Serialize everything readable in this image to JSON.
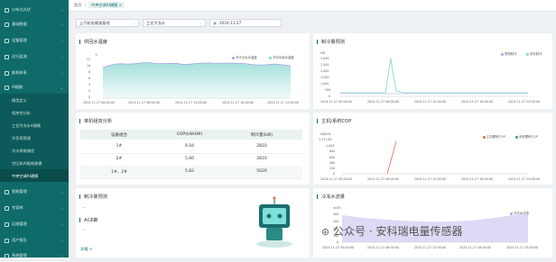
{
  "sidebar": {
    "items": [
      {
        "label": "分布式光伏"
      },
      {
        "label": "基础数据"
      },
      {
        "label": "设备管理"
      },
      {
        "label": "运行监测"
      },
      {
        "label": "能耗体系"
      },
      {
        "label": "AI赋能"
      }
    ],
    "subitems": [
      {
        "label": "模型定义"
      },
      {
        "label": "相关性分析"
      },
      {
        "label": "工艺冷冻水4建模"
      },
      {
        "label": "冷负荷预测"
      },
      {
        "label": "冷水系统调优"
      },
      {
        "label": "空压机AI能效建模"
      },
      {
        "label": "中央空调AI建模"
      }
    ],
    "items_after": [
      {
        "label": "智能管理"
      },
      {
        "label": "专家库"
      },
      {
        "label": "运维管理"
      },
      {
        "label": "用户报告"
      },
      {
        "label": "系统管理"
      }
    ]
  },
  "topbar": {
    "home": "首页",
    "tab": "中央空调AI建模",
    "close": "×"
  },
  "filters": {
    "site": "上汽轮驱威驰基地",
    "process": "工艺冷冻水",
    "date": "2024-11-27"
  },
  "supply_temp": {
    "title": "供回水温度",
    "unit": "℃",
    "legend": [
      "冷冻水出水温度",
      "冷冻水回水温度"
    ],
    "colors": [
      "#a8a4e6",
      "#7fd3cc"
    ],
    "yticks": [
      "12",
      "10",
      "8",
      "6",
      "4",
      "2",
      "0"
    ],
    "xticks": [
      "2024-11-27 00:00:00",
      "2024-11-27 06:00:00",
      "2024-11-27 12:00:00",
      "2024-11-27 18:00:00",
      "2024-11-27 23:00:00"
    ]
  },
  "cooling_forecast": {
    "title": "制冷量预测",
    "unit": "kW",
    "legend": [
      "预测制冷",
      "实际制冷"
    ],
    "colors": [
      "#a8a4e6",
      "#7fd3cc"
    ],
    "yticks": [
      "3,000",
      "2,500",
      "2,000",
      "1,500",
      "1,000",
      "500",
      "0"
    ],
    "xticks": [
      "2024-11-27 00:00:00",
      "2024-11-27 06:00:00",
      "2024-11-27 12:00:00",
      "2024-11-27 18:00:00",
      "2024-11-27 23:00:00"
    ]
  },
  "unit_table": {
    "title": "单机组效分析",
    "headers": [
      "设备组合",
      "COP(kW/kW)",
      "制冷量(kW)"
    ],
    "rows": [
      {
        "combo": "1#",
        "cop": "6.04",
        "cap": "2810"
      },
      {
        "combo": "2#",
        "cop": "5.60",
        "cap": "2810"
      },
      {
        "combo": "1#、2#",
        "cop": "5.82",
        "cap": "5620"
      }
    ]
  },
  "cop_chart": {
    "title": "主机/系统COP",
    "unit": "kW/kW",
    "legend": [
      "主机累积COP",
      "系统累积COP"
    ],
    "colors": [
      "#e06b4f",
      "#2f9c94"
    ],
    "yticks": [
      "1,171.62",
      "1,000",
      "800",
      "600",
      "400",
      "200",
      "0"
    ],
    "xticks": [
      "2024-11-27 00:00:00",
      "2024-11-27 06:00:00",
      "2024-11-27 12:00:00",
      "2024-11-27 18:00:00",
      "2024-11-27 23:00:00"
    ]
  },
  "cold_forecast": {
    "title": "制冷量预测",
    "dash": "--"
  },
  "ai_decision": {
    "title": "AI决策",
    "dash": "--",
    "details": "详情 >"
  },
  "chilled_flow": {
    "title": "冷冻水流量",
    "unit": "m3/h",
    "legend": [
      "冷冻水流量"
    ],
    "colors": [
      "#a8a4e6"
    ],
    "yticks": [
      "400",
      "300",
      "200",
      "100",
      "0"
    ],
    "xticks": [
      "2024-11-27 00:00:00",
      "2024-11-27 06:00:00",
      "2024-11-27 12:00:00",
      "2024-11-27 18:00:00",
      "2024-11-27 23:00:00"
    ]
  },
  "watermark": "公众号 · 安科瑞电量传感器"
}
